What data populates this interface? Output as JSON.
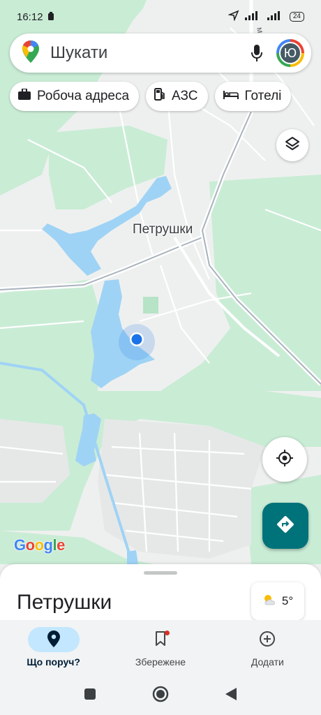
{
  "status_bar": {
    "time": "16:12",
    "battery": "24"
  },
  "search": {
    "placeholder": "Шукати"
  },
  "account": {
    "initial": "Ю"
  },
  "chips": [
    {
      "label": "Робоча адреса",
      "icon": "briefcase-icon"
    },
    {
      "label": "АЗС",
      "icon": "gas-station-icon"
    },
    {
      "label": "Готелі",
      "icon": "bed-icon"
    }
  ],
  "map": {
    "place_label": "Петрушки",
    "street_label": "марова",
    "google_logo": "Google",
    "colors": {
      "water": "#9fd3f5",
      "green": "#c9ecd5",
      "land": "#eef0ef",
      "user_dot": "#1a73e8",
      "directions": "#00737a"
    }
  },
  "sheet": {
    "title": "Петрушки",
    "weather": {
      "temperature": "5°",
      "icon": "partly-cloudy-icon"
    }
  },
  "bottom_nav": [
    {
      "label": "Що поруч?",
      "icon": "explore-pin-icon",
      "active": true
    },
    {
      "label": "Збережене",
      "icon": "bookmark-icon",
      "active": false
    },
    {
      "label": "Додати",
      "icon": "add-circle-icon",
      "active": false
    }
  ]
}
